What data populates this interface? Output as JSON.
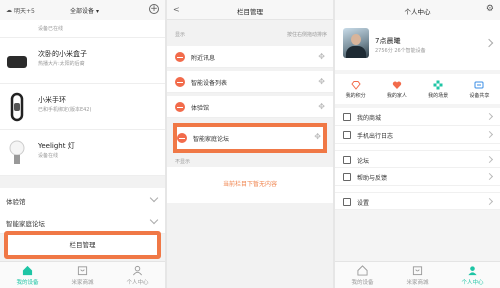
{
  "panel1": {
    "weather": "明天+5",
    "all_devices": "全部设备",
    "add_symbol": "+",
    "devices": [
      {
        "name": "",
        "status": "设备已在线"
      },
      {
        "name": "次卧的小米盒子",
        "status": "热播大片:太阳的后裔"
      },
      {
        "name": "小米手环",
        "status": "已和手机绑定(版本E42)"
      },
      {
        "name": "Yeelight 灯",
        "status": "设备在线"
      }
    ],
    "rows": [
      "体验馆",
      "智能家庭论坛"
    ],
    "manage_button": "栏目管理",
    "tabs": [
      {
        "label": "我的设备",
        "active": true
      },
      {
        "label": "米家商城",
        "active": false
      },
      {
        "label": "个人中心",
        "active": false
      }
    ]
  },
  "panel2": {
    "back": "<",
    "title": "栏目管理",
    "shown_header": "显示",
    "shown_hint": "按住右侧拖动排序",
    "items": [
      "附近讯息",
      "智能设备列表",
      "体验馆"
    ],
    "highlighted_item": "智能家庭论坛",
    "hidden_header": "不显示",
    "empty_text": "当前栏目下暂无内容",
    "drag_glyph": "✥"
  },
  "panel3": {
    "title": "个人中心",
    "profile": {
      "name": "7点晨曦",
      "info": "2756分  26个智能设备"
    },
    "quick": [
      {
        "label": "我的积分",
        "icon": "diamond-icon",
        "color": "#f26b4b"
      },
      {
        "label": "我的家人",
        "icon": "heart-icon",
        "color": "#f26b4b"
      },
      {
        "label": "我的场景",
        "icon": "scene-icon",
        "color": "#1ec5a5"
      },
      {
        "label": "设备共享",
        "icon": "share-icon",
        "color": "#3a8ee6"
      }
    ],
    "menu": [
      "我的商城",
      "手机出行日志",
      "论坛",
      "帮助与反馈",
      "设置"
    ],
    "tabs": [
      {
        "label": "我的设备",
        "active": false
      },
      {
        "label": "米家商城",
        "active": false
      },
      {
        "label": "个人中心",
        "active": true
      }
    ]
  },
  "colors": {
    "accent": "#1ec5a5",
    "highlight": "#f07846",
    "remove": "#f26b4b"
  }
}
